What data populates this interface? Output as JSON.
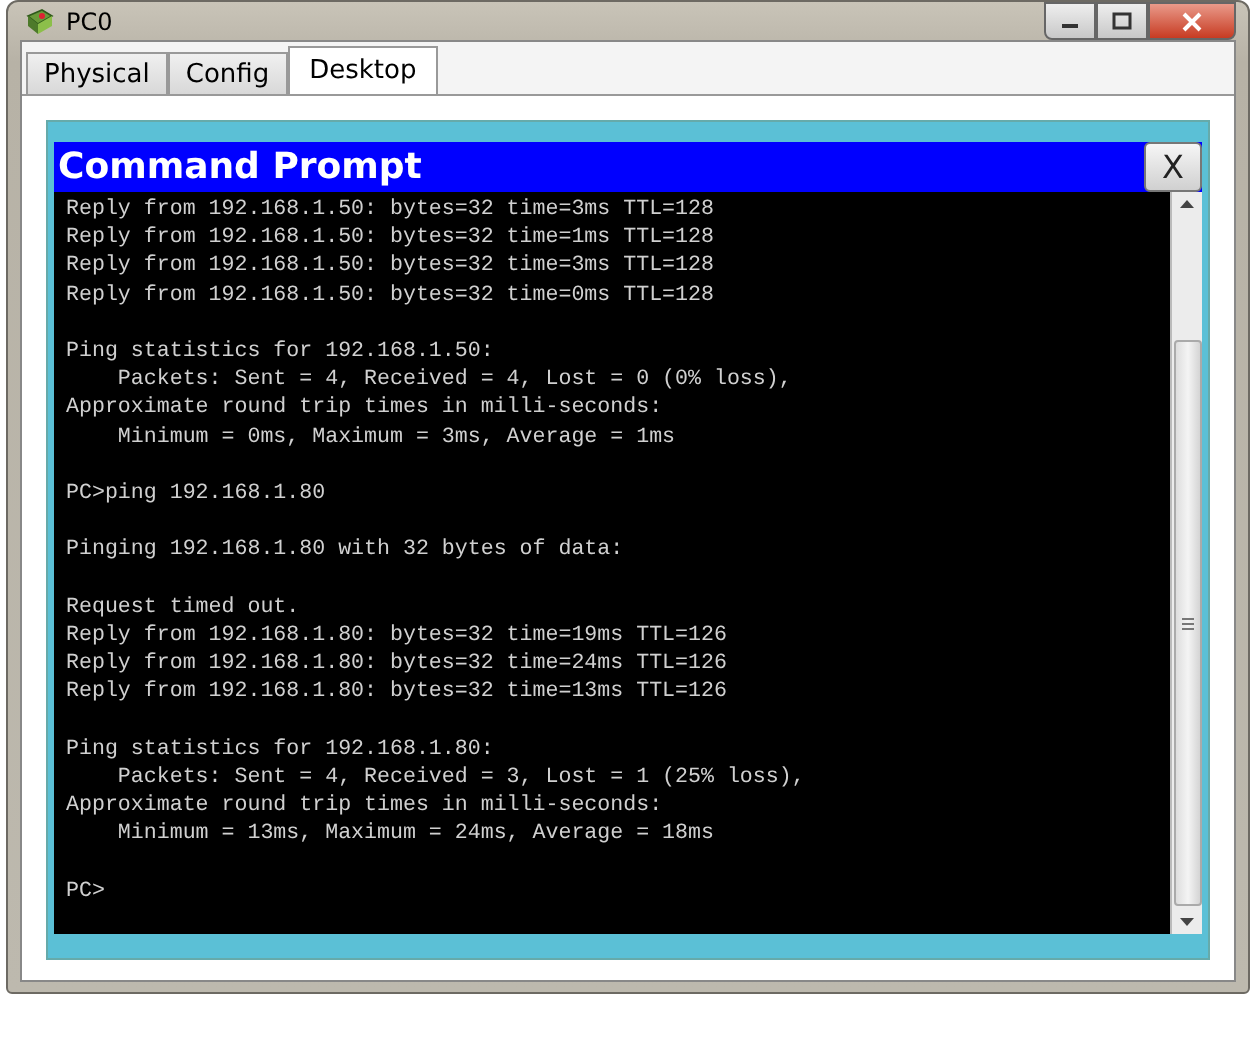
{
  "window": {
    "title": "PC0"
  },
  "tabs": [
    {
      "label": "Physical",
      "selected": false
    },
    {
      "label": "Config",
      "selected": false
    },
    {
      "label": "Desktop",
      "selected": true
    }
  ],
  "command_prompt": {
    "title": "Command Prompt",
    "close_label": "X",
    "blocks": [
      [
        "Reply from 192.168.1.50: bytes=32 time=3ms TTL=128",
        "Reply from 192.168.1.50: bytes=32 time=1ms TTL=128",
        "Reply from 192.168.1.50: bytes=32 time=3ms TTL=128",
        "Reply from 192.168.1.50: bytes=32 time=0ms TTL=128"
      ],
      [
        "Ping statistics for 192.168.1.50:",
        "    Packets: Sent = 4, Received = 4, Lost = 0 (0% loss),",
        "Approximate round trip times in milli-seconds:",
        "    Minimum = 0ms, Maximum = 3ms, Average = 1ms"
      ],
      [
        "PC>ping 192.168.1.80"
      ],
      [
        "Pinging 192.168.1.80 with 32 bytes of data:"
      ],
      [
        "Request timed out.",
        "Reply from 192.168.1.80: bytes=32 time=19ms TTL=126",
        "Reply from 192.168.1.80: bytes=32 time=24ms TTL=126",
        "Reply from 192.168.1.80: bytes=32 time=13ms TTL=126"
      ],
      [
        "Ping statistics for 192.168.1.80:",
        "    Packets: Sent = 4, Received = 3, Lost = 1 (25% loss),",
        "Approximate round trip times in milli-seconds:",
        "    Minimum = 13ms, Maximum = 24ms, Average = 18ms"
      ],
      [
        "PC>"
      ]
    ]
  }
}
